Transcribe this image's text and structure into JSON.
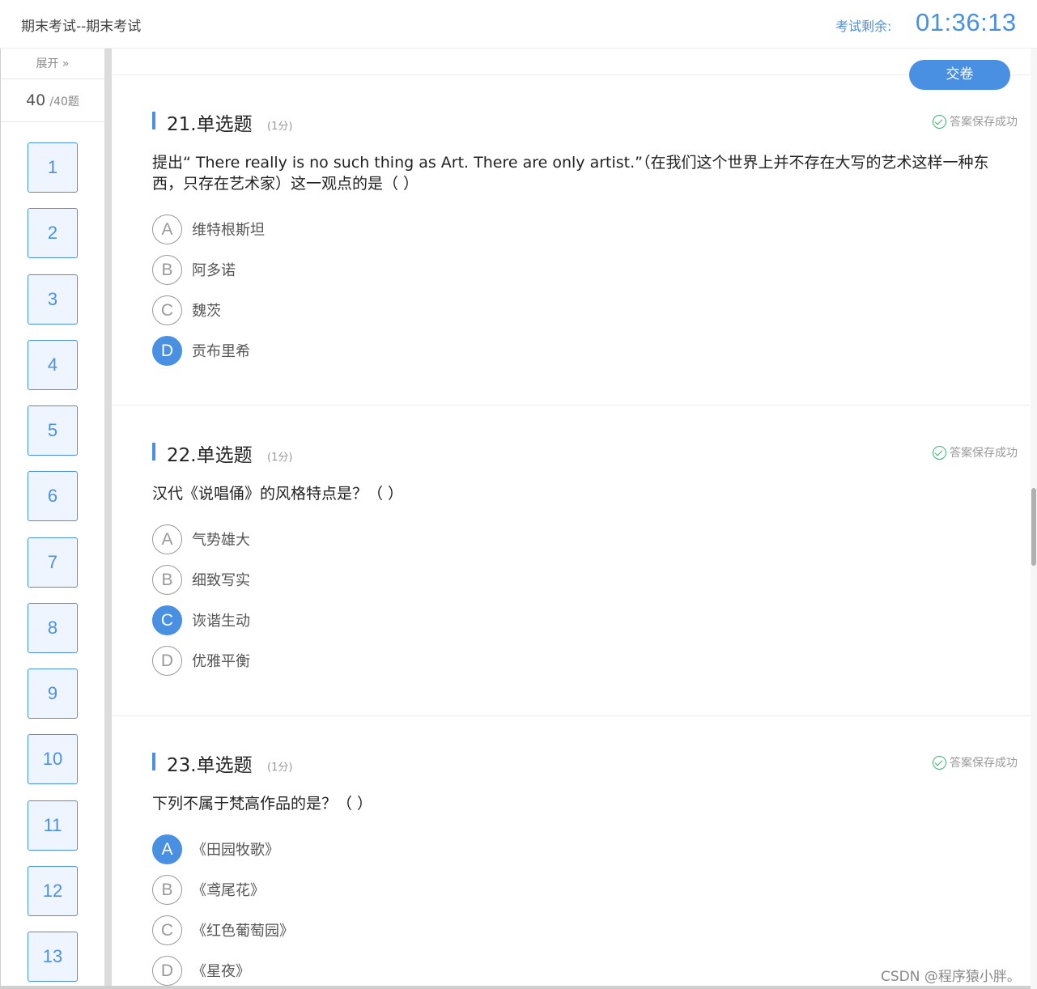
{
  "header": {
    "title": "期末考试--期末考试",
    "timer_label": "考试剩余:",
    "timer": "01:36:13"
  },
  "sidebar": {
    "expand_label": "展开 »",
    "answered": "40",
    "total": "/40题",
    "questions": [
      "1",
      "2",
      "3",
      "4",
      "5",
      "6",
      "7",
      "8",
      "9",
      "10",
      "11",
      "12",
      "13"
    ]
  },
  "main": {
    "submit_label": "交卷",
    "questions": [
      {
        "title": "21.单选题",
        "score": "(1分)",
        "saved": "答案保存成功",
        "stem": "提出“ There really is no such thing as Art. There are only artist.”（在我们这个世界上并不存在大写的艺术这样一种东西，只存在艺术家）这一观点的是（ ）",
        "options": [
          {
            "letter": "A",
            "text": "维特根斯坦"
          },
          {
            "letter": "B",
            "text": "阿多诺"
          },
          {
            "letter": "C",
            "text": "魏茨"
          },
          {
            "letter": "D",
            "text": "贡布里希"
          }
        ],
        "selected": "D"
      },
      {
        "title": "22.单选题",
        "score": "(1分)",
        "saved": "答案保存成功",
        "stem": "汉代《说唱俑》的风格特点是？（ ）",
        "options": [
          {
            "letter": "A",
            "text": "气势雄大"
          },
          {
            "letter": "B",
            "text": "细致写实"
          },
          {
            "letter": "C",
            "text": "诙谐生动"
          },
          {
            "letter": "D",
            "text": "优雅平衡"
          }
        ],
        "selected": "C"
      },
      {
        "title": "23.单选题",
        "score": "(1分)",
        "saved": "答案保存成功",
        "stem": "下列不属于梵高作品的是？（ ）",
        "options": [
          {
            "letter": "A",
            "text": "《田园牧歌》"
          },
          {
            "letter": "B",
            "text": "《鸢尾花》"
          },
          {
            "letter": "C",
            "text": "《红色葡萄园》"
          },
          {
            "letter": "D",
            "text": "《星夜》"
          }
        ],
        "selected": "A"
      }
    ]
  },
  "watermark": "CSDN @程序猿小胖。",
  "colors": {
    "accent": "#4a90e2",
    "success": "#3cb371"
  }
}
